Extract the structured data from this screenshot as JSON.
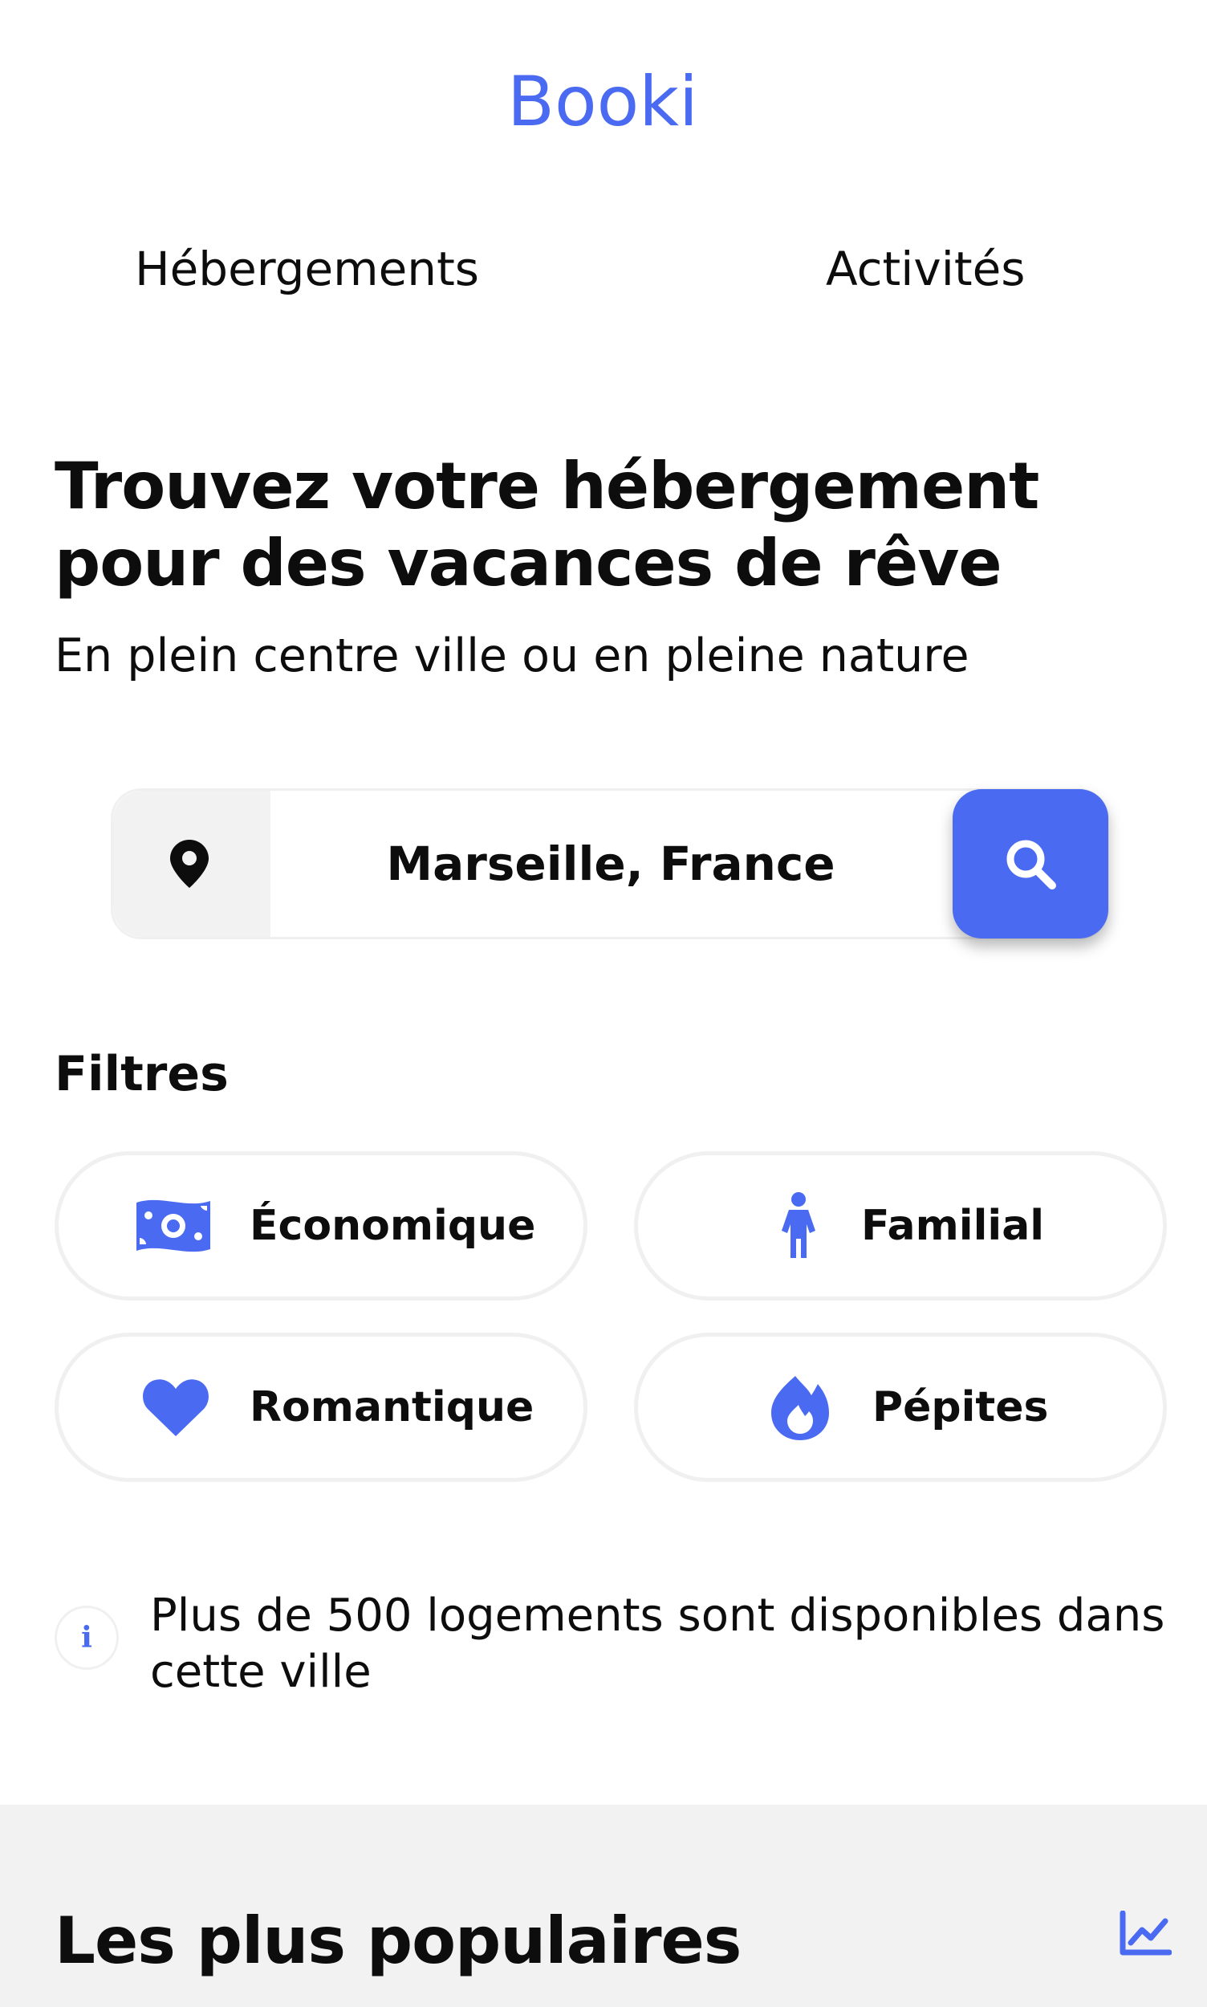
{
  "colors": {
    "accent": "#4a6af2",
    "text": "#0d0d0d",
    "section_bg": "#f2f2f2",
    "border": "#f0f0f0"
  },
  "header": {
    "logo": "Booki",
    "nav": [
      {
        "label": "Hébergements"
      },
      {
        "label": "Activités"
      }
    ]
  },
  "hero": {
    "title": "Trouvez votre hébergement pour des vacances de rêve",
    "subtitle": "En plein centre ville ou en pleine nature"
  },
  "search": {
    "value": "Marseille, France",
    "pin_icon": "location-pin-icon",
    "button_icon": "search-icon"
  },
  "filters": {
    "title": "Filtres",
    "items": [
      {
        "label": "Économique",
        "icon": "money-bill-icon"
      },
      {
        "label": "Familial",
        "icon": "child-icon"
      },
      {
        "label": "Romantique",
        "icon": "heart-icon"
      },
      {
        "label": "Pépites",
        "icon": "fire-icon"
      }
    ]
  },
  "info": {
    "badge": "i",
    "text": "Plus de 500 logements sont disponibles dans cette ville"
  },
  "popular": {
    "title": "Les plus populaires",
    "icon": "chart-line-icon"
  }
}
